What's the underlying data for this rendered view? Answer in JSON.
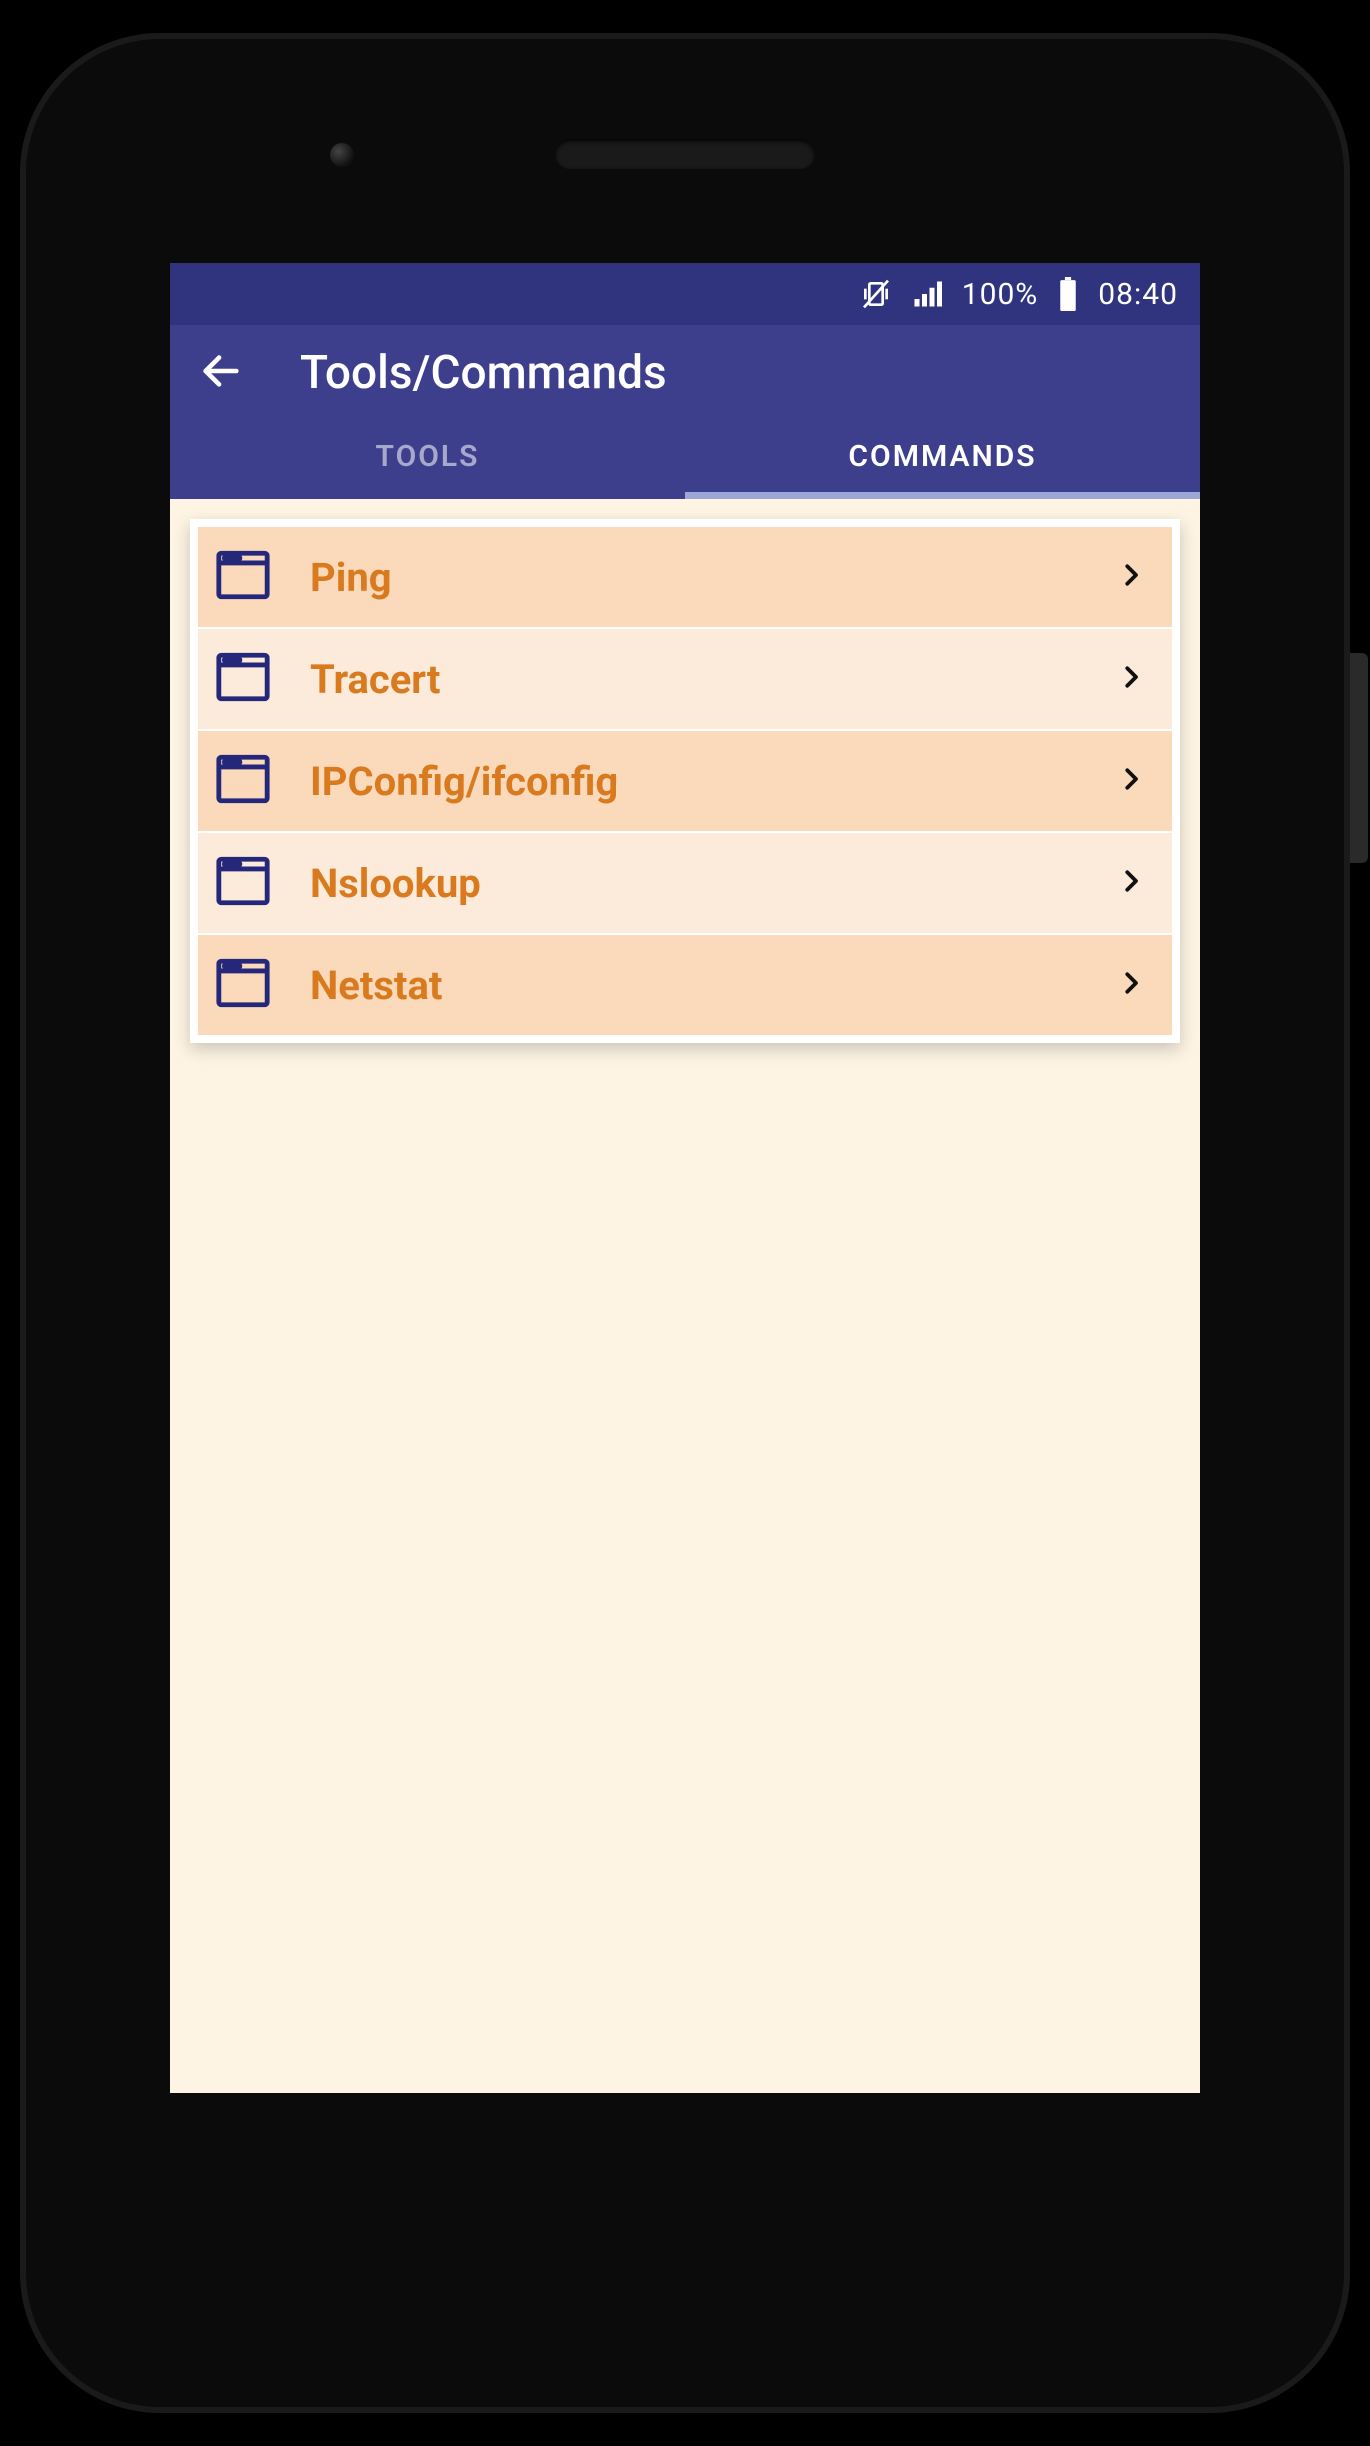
{
  "statusbar": {
    "battery_pct": "100%",
    "time": "08:40",
    "icons": [
      "vibrate-icon",
      "signal-icon",
      "battery-icon"
    ]
  },
  "header": {
    "title": "Tools/Commands"
  },
  "tabs": [
    {
      "label": "TOOLS",
      "active": false
    },
    {
      "label": "COMMANDS",
      "active": true
    }
  ],
  "list": [
    {
      "label": "Ping"
    },
    {
      "label": "Tracert"
    },
    {
      "label": "IPConfig/ifconfig"
    },
    {
      "label": "Nslookup"
    },
    {
      "label": "Netstat"
    }
  ],
  "colors": {
    "appbar": "#3D3F8C",
    "statusbar": "#30347E",
    "accent": "#D97A1E",
    "row_odd": "#FADABB",
    "row_even": "#FCEBDA",
    "surface": "#FDF4E3"
  }
}
